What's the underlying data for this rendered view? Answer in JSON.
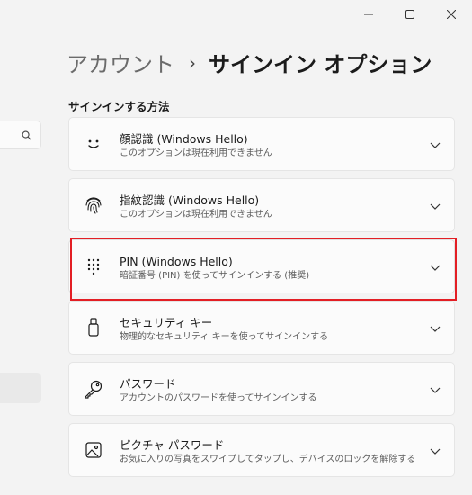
{
  "window": {
    "minimize_icon": "minimize-icon",
    "maximize_icon": "maximize-icon",
    "close_icon": "close-icon"
  },
  "breadcrumb": {
    "parent": "アカウント",
    "separator": "›",
    "current": "サインイン オプション"
  },
  "sidebar": {
    "search_icon": "search-icon"
  },
  "section_heading": "サインインする方法",
  "options": [
    {
      "icon": "face-icon",
      "title": "顔認識 (Windows Hello)",
      "description": "このオプションは現在利用できません"
    },
    {
      "icon": "fingerprint-icon",
      "title": "指紋認識 (Windows Hello)",
      "description": "このオプションは現在利用できません"
    },
    {
      "icon": "pin-keypad-icon",
      "title": "PIN (Windows Hello)",
      "description": "暗証番号 (PIN) を使ってサインインする (推奨)"
    },
    {
      "icon": "security-key-icon",
      "title": "セキュリティ キー",
      "description": "物理的なセキュリティ キーを使ってサインインする"
    },
    {
      "icon": "key-icon",
      "title": "パスワード",
      "description": "アカウントのパスワードを使ってサインインする"
    },
    {
      "icon": "picture-password-icon",
      "title": "ピクチャ パスワード",
      "description": "お気に入りの写真をスワイプしてタップし、デバイスのロックを解除する"
    }
  ],
  "highlight_color": "#e31e24"
}
